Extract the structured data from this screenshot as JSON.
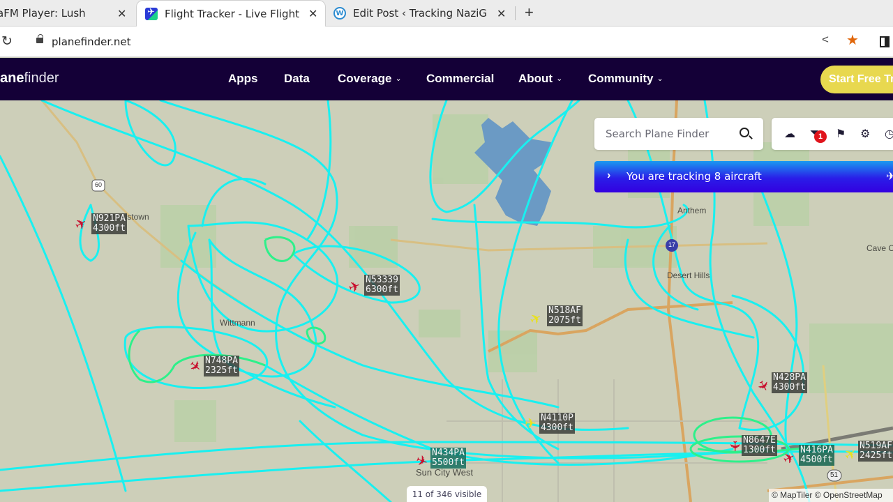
{
  "browser": {
    "tabs": [
      {
        "title": "aFM Player: Lush",
        "favicon": "radio-icon",
        "active": false
      },
      {
        "title": "Flight Tracker - Live Flight",
        "favicon": "planefinder-icon",
        "active": true
      },
      {
        "title": "Edit Post ‹ Tracking NaziG",
        "favicon": "wordpress-icon",
        "active": false
      }
    ],
    "new_tab_label": "+",
    "close_glyph": "✕",
    "url": "planefinder.net"
  },
  "site": {
    "logo_bold": "ane",
    "logo_light": "finder",
    "nav": [
      {
        "label": "Apps",
        "dropdown": false
      },
      {
        "label": "Data",
        "dropdown": false
      },
      {
        "label": "Coverage",
        "dropdown": true
      },
      {
        "label": "Commercial",
        "dropdown": false
      },
      {
        "label": "About",
        "dropdown": true
      },
      {
        "label": "Community",
        "dropdown": true
      }
    ],
    "cta_label": "Start Free Trial"
  },
  "search": {
    "placeholder": "Search Plane Finder"
  },
  "tools": {
    "icons": [
      "weather-icon",
      "filter-icon",
      "bookmark-icon",
      "settings-icon",
      "history-icon"
    ],
    "filter_badge": "1"
  },
  "tracking_banner": {
    "text": "You are tracking 8 aircraft"
  },
  "map": {
    "places": [
      "Morristown",
      "Wittmann",
      "Anthem",
      "Desert Hills",
      "Cave Creek",
      "Sun City West"
    ],
    "highway_shields": [
      "60",
      "17",
      "51"
    ],
    "aircraft": [
      {
        "callsign": "N921PA",
        "altitude": "4300ft",
        "color": "#c8102e"
      },
      {
        "callsign": "N53339",
        "altitude": "6300ft",
        "color": "#c8102e"
      },
      {
        "callsign": "N518AF",
        "altitude": "2075ft",
        "color": "#e8e020"
      },
      {
        "callsign": "N748PA",
        "altitude": "2325ft",
        "color": "#c8102e"
      },
      {
        "callsign": "N428PA",
        "altitude": "4300ft",
        "color": "#c8102e"
      },
      {
        "callsign": "N4110P",
        "altitude": "4300ft",
        "color": "#e8e020"
      },
      {
        "callsign": "N8647E",
        "altitude": "1300ft",
        "color": "#c8102e"
      },
      {
        "callsign": "N434PA",
        "altitude": "5500ft",
        "color": "#c8102e"
      },
      {
        "callsign": "N416PA",
        "altitude": "4500ft",
        "color": "#c8102e"
      },
      {
        "callsign": "N519AF",
        "altitude": "2425ft",
        "color": "#e8e020"
      }
    ],
    "track_colors": {
      "primary": "#19f0f0",
      "low": "#2ef08a"
    },
    "visible_count": "11 of 346 visible",
    "attribution": "© MapTiler © OpenStreetMap"
  }
}
